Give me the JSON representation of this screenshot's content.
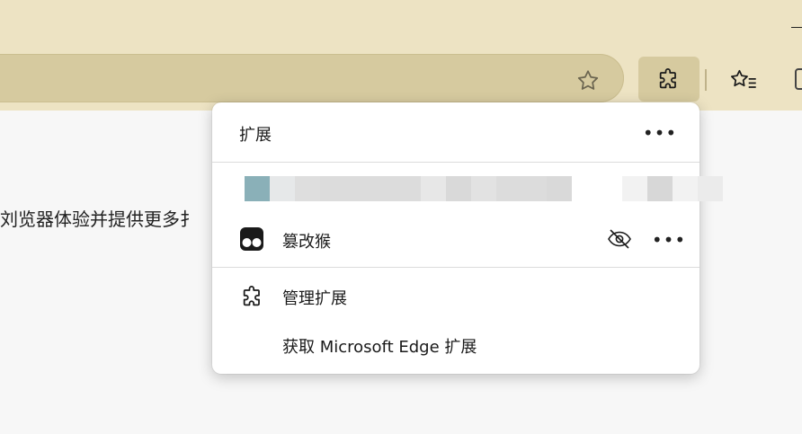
{
  "page": {
    "body_text": "刘览器体验并提供更多扌"
  },
  "toolbar": {
    "favorite_icon": "star-outline-icon",
    "extensions_icon": "puzzle-piece-icon",
    "favorites_icon": "star-list-icon"
  },
  "extensions_menu": {
    "title": "扩展",
    "more_label": "•••",
    "hidden_item_pixels": [
      "#8ab0b8",
      "#e6e8e9",
      "#dedede",
      "#dcdcdc",
      "#dcdcdc",
      "#dcdcdc",
      "#dcdcdc",
      "#e7e7e7",
      "#d9d9d9",
      "#e2e2e2",
      "#dcdcdc",
      "#dcdcdc",
      "#d9d9d9",
      "#ffffff",
      "#ffffff",
      "#f2f2f2",
      "#d7d7d7",
      "#f2f2f2",
      "#ebebeb"
    ],
    "extensions": [
      {
        "name": "篡改猴",
        "icon": "tampermonkey-icon",
        "visibility_icon": "eye-hidden-icon",
        "more_label": "•••"
      }
    ],
    "manage_label": "管理扩展",
    "manage_icon": "puzzle-piece-icon",
    "get_extensions_label": "获取 Microsoft Edge 扩展"
  },
  "colors": {
    "titlebar": "#ede3c3",
    "addressbar": "#d6ca9f",
    "popup_bg": "#ffffff"
  }
}
